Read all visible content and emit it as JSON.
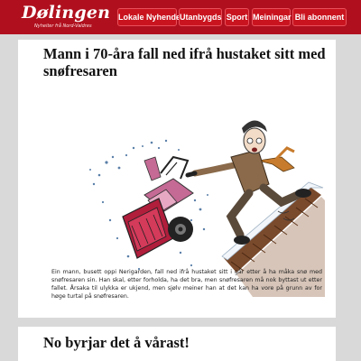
{
  "header": {
    "logo_text": "Dølingen",
    "logo_tagline": "Nyheiter frå Nord-Valdres"
  },
  "nav": [
    {
      "label": "Lokale Nyhende"
    },
    {
      "label": "Utanbygds"
    },
    {
      "label": "Sport"
    },
    {
      "label": "Meiningar"
    },
    {
      "label": "Bli abonnent"
    }
  ],
  "colors": {
    "header_bg": "#b0101e",
    "nav_bg": "#c9141f",
    "page_bg": "#d9d9d9",
    "card_bg": "#ffffff"
  },
  "articles": [
    {
      "title": "Mann i 70-åra fall ned ifrå hustaket sitt med snøfresaren",
      "body": "Ein mann, busett oppi Nerigarden, fall ned ifrå hustaket sitt i går etter å ha måka snø med snøfresaren sin. Han skal, etter forholda, ha det bra, men snøfresaren må nok byttast ut etter fallet. Årsaka til ulykka er ukjend, men sjølv meiner han at det kan ha vore på grunn av for høge turtal på snøfresaren."
    },
    {
      "title": "No byrjar det å vårast!"
    }
  ]
}
